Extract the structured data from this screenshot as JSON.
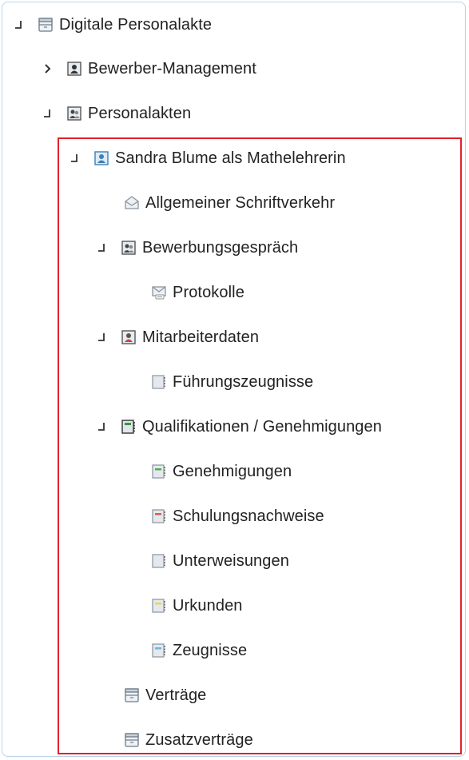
{
  "tree": {
    "items": [
      {
        "label": "Digitale Personalakte",
        "toggle": "expanded",
        "icon": "archive-cabinet-icon"
      },
      {
        "label": "Bewerber-Management",
        "toggle": "collapsed",
        "icon": "person-folder-icon"
      },
      {
        "label": "Personalakten",
        "toggle": "expanded",
        "icon": "group-folder-icon"
      },
      {
        "label": "Sandra Blume als Mathelehrerin",
        "toggle": "expanded",
        "icon": "person-folder-blue-icon"
      },
      {
        "label": "Allgemeiner Schriftverkehr",
        "toggle": "none",
        "icon": "envelope-shield-icon"
      },
      {
        "label": "Bewerbungsgespräch",
        "toggle": "expanded",
        "icon": "group-folder-icon"
      },
      {
        "label": "Protokolle",
        "toggle": "none",
        "icon": "envelope-message-icon"
      },
      {
        "label": "Mitarbeiterdaten",
        "toggle": "expanded",
        "icon": "person-folder-icon"
      },
      {
        "label": "Führungszeugnisse",
        "toggle": "none",
        "icon": "register-gray-icon"
      },
      {
        "label": "Qualifikationen / Genehmigungen",
        "toggle": "expanded",
        "icon": "register-green-icon"
      },
      {
        "label": "Genehmigungen",
        "toggle": "none",
        "icon": "register-green-icon"
      },
      {
        "label": "Schulungsnachweise",
        "toggle": "none",
        "icon": "register-red-icon"
      },
      {
        "label": "Unterweisungen",
        "toggle": "none",
        "icon": "register-gray-icon"
      },
      {
        "label": "Urkunden",
        "toggle": "none",
        "icon": "register-yellow-icon"
      },
      {
        "label": "Zeugnisse",
        "toggle": "none",
        "icon": "register-blue-icon"
      },
      {
        "label": "Verträge",
        "toggle": "none",
        "icon": "archive-cabinet-icon"
      },
      {
        "label": "Zusatzverträge",
        "toggle": "none",
        "icon": "archive-cabinet-icon"
      }
    ]
  },
  "colors": {
    "highlight": "#e3202a",
    "tab_green": "#4caf50",
    "tab_red": "#e05a4a",
    "tab_yellow": "#e9d94a",
    "tab_blue": "#6cb7e6"
  }
}
